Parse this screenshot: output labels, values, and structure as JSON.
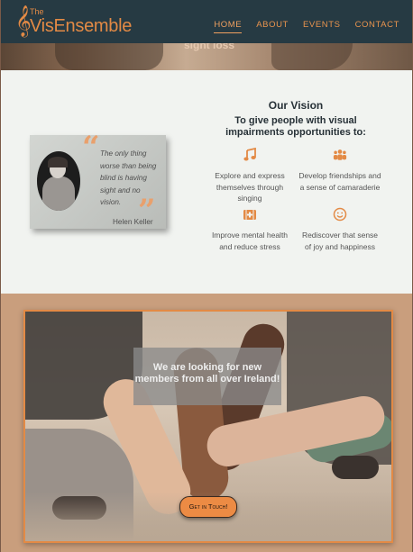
{
  "header": {
    "logo_the": "The",
    "logo_name": "VisEnsemble",
    "nav": [
      {
        "label": "HOME",
        "active": true
      },
      {
        "label": "ABOUT",
        "active": false
      },
      {
        "label": "EVENTS",
        "active": false
      },
      {
        "label": "CONTACT",
        "active": false
      }
    ]
  },
  "hero_strip": {
    "text": "sight loss"
  },
  "quote": {
    "text": "The only thing worse than being blind is having sight and no vision.",
    "author": "Helen Keller"
  },
  "vision": {
    "title": "Our Vision",
    "subtitle": "To give people with visual impairments opportunities to:",
    "features": [
      {
        "icon": "music-note-icon",
        "text": "Explore and express themselves through singing"
      },
      {
        "icon": "people-group-icon",
        "text": "Develop friendships and a sense of camaraderie"
      },
      {
        "icon": "medical-kit-icon",
        "text": "Improve mental health and reduce stress"
      },
      {
        "icon": "smiley-face-icon",
        "text": "Rediscover that sense of joy and happiness"
      }
    ]
  },
  "recruit": {
    "text": "We are looking for new members from all over Ireland!",
    "cta_label": "Get in Touch!"
  },
  "colors": {
    "accent": "#e38a45",
    "header_bg": "#263a43",
    "section_bg": "#f1f3f0"
  }
}
